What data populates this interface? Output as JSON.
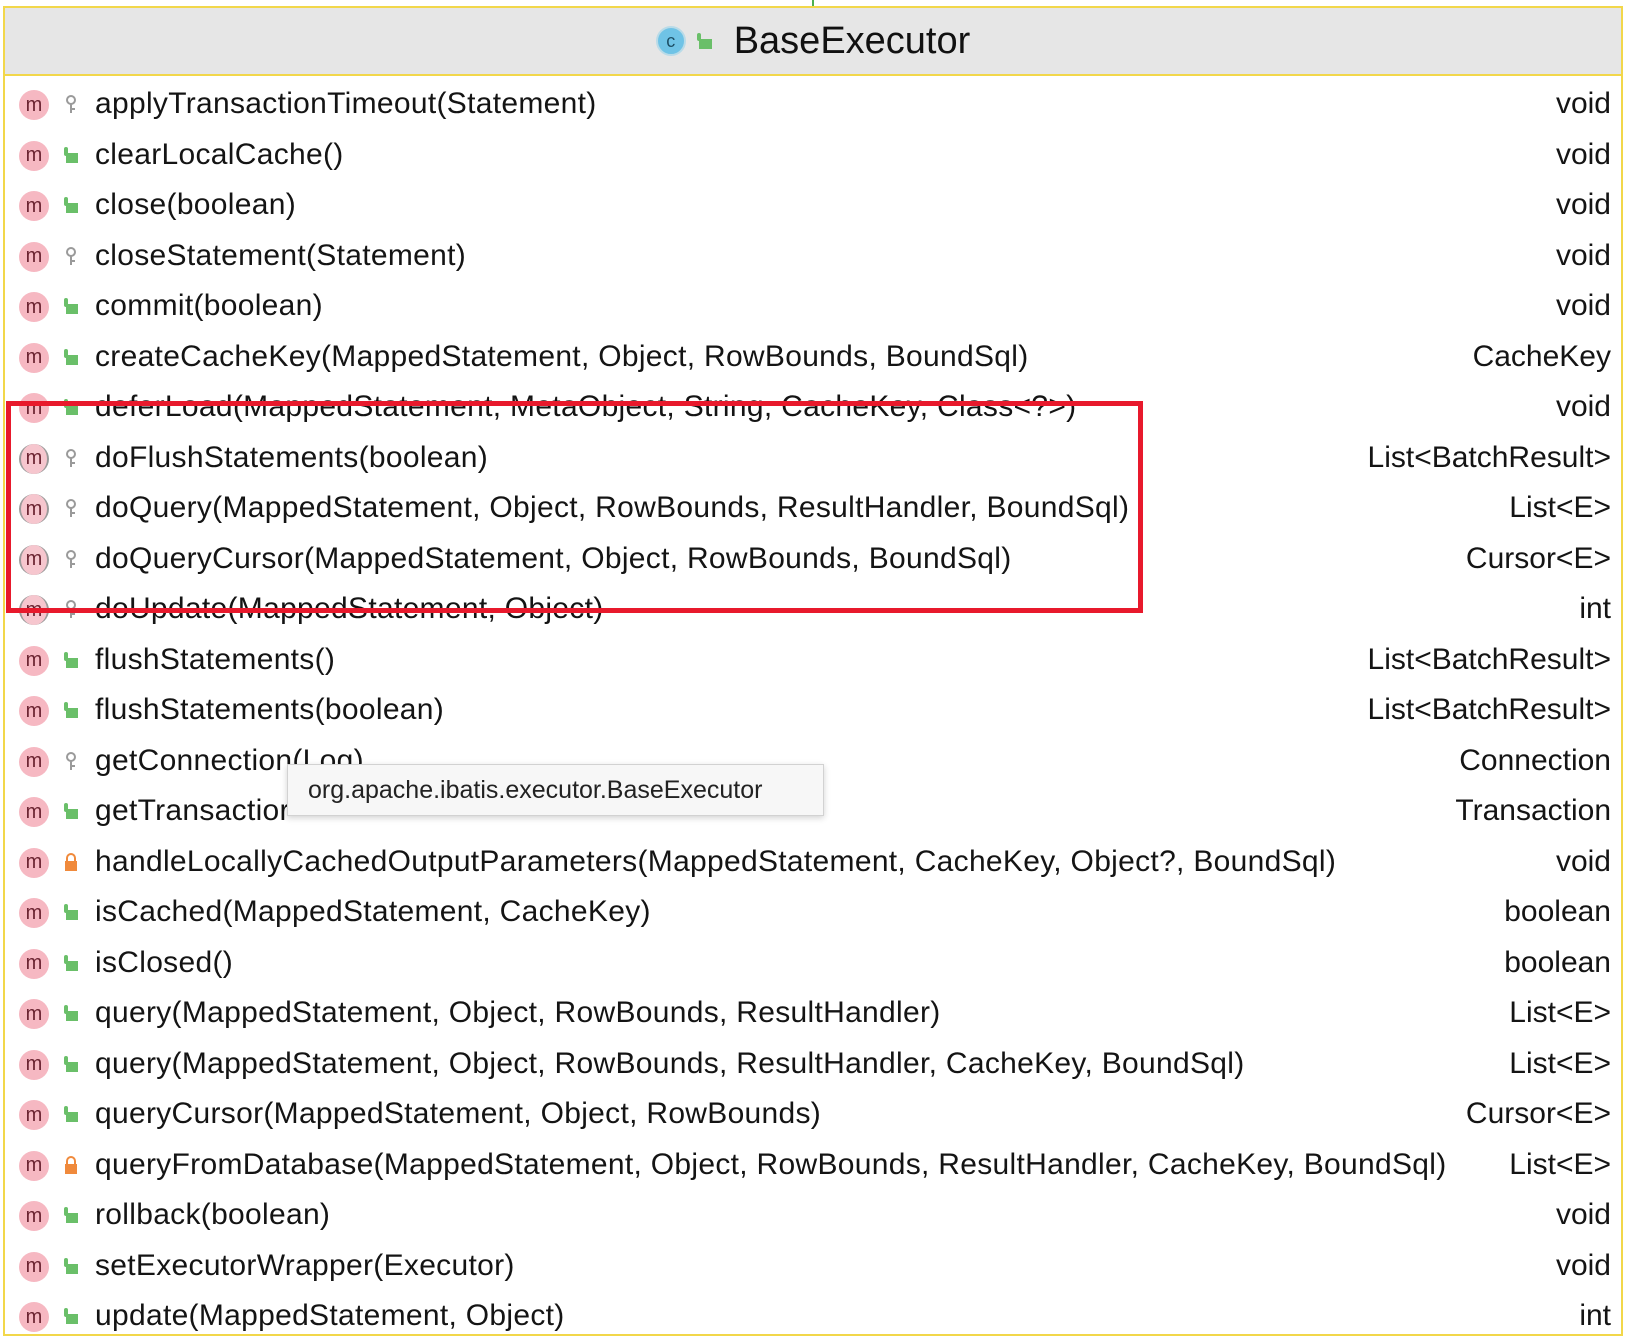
{
  "class": {
    "icon_letter": "c",
    "title": "BaseExecutor"
  },
  "colors": {
    "border": "#f2d74a",
    "header_bg": "#e6e6e6",
    "method_icon": "#f6b8c2",
    "public_icon": "#6abf69",
    "protected_icon": "#9a9a9a",
    "private_icon": "#f08a3c",
    "highlight": "#e8192c"
  },
  "methods": [
    {
      "icon": "m",
      "visibility": "protected",
      "name": "applyTransactionTimeout(Statement)",
      "return": "void"
    },
    {
      "icon": "m",
      "visibility": "public",
      "name": "clearLocalCache()",
      "return": "void"
    },
    {
      "icon": "m",
      "visibility": "public",
      "name": "close(boolean)",
      "return": "void"
    },
    {
      "icon": "m",
      "visibility": "protected",
      "name": "closeStatement(Statement)",
      "return": "void"
    },
    {
      "icon": "m",
      "visibility": "public",
      "name": "commit(boolean)",
      "return": "void"
    },
    {
      "icon": "m",
      "visibility": "public",
      "name": "createCacheKey(MappedStatement, Object, RowBounds, BoundSql)",
      "return": "CacheKey"
    },
    {
      "icon": "m",
      "visibility": "public",
      "name": "deferLoad(MappedStatement, MetaObject, String, CacheKey, Class<?>)",
      "return": "void"
    },
    {
      "icon": "m",
      "visibility": "protected",
      "abstract": true,
      "name": "doFlushStatements(boolean)",
      "return": "List<BatchResult>"
    },
    {
      "icon": "m",
      "visibility": "protected",
      "abstract": true,
      "name": "doQuery(MappedStatement, Object, RowBounds, ResultHandler, BoundSql)",
      "return": "List<E>"
    },
    {
      "icon": "m",
      "visibility": "protected",
      "abstract": true,
      "name": "doQueryCursor(MappedStatement, Object, RowBounds, BoundSql)",
      "return": "Cursor<E>"
    },
    {
      "icon": "m",
      "visibility": "protected",
      "abstract": true,
      "name": "doUpdate(MappedStatement, Object)",
      "return": "int"
    },
    {
      "icon": "m",
      "visibility": "public",
      "name": "flushStatements()",
      "return": "List<BatchResult>"
    },
    {
      "icon": "m",
      "visibility": "public",
      "name": "flushStatements(boolean)",
      "return": "List<BatchResult>"
    },
    {
      "icon": "m",
      "visibility": "protected",
      "name": "getConnection(Log)",
      "return": "Connection"
    },
    {
      "icon": "m",
      "visibility": "public",
      "name": "getTransactior",
      "return": "Transaction"
    },
    {
      "icon": "m",
      "visibility": "private",
      "name": "handleLocallyCachedOutputParameters(MappedStatement, CacheKey, Object?, BoundSql)",
      "return": "void"
    },
    {
      "icon": "m",
      "visibility": "public",
      "name": "isCached(MappedStatement, CacheKey)",
      "return": "boolean"
    },
    {
      "icon": "m",
      "visibility": "public",
      "name": "isClosed()",
      "return": "boolean"
    },
    {
      "icon": "m",
      "visibility": "public",
      "name": "query(MappedStatement, Object, RowBounds, ResultHandler)",
      "return": "List<E>"
    },
    {
      "icon": "m",
      "visibility": "public",
      "name": "query(MappedStatement, Object, RowBounds, ResultHandler, CacheKey, BoundSql)",
      "return": "List<E>"
    },
    {
      "icon": "m",
      "visibility": "public",
      "name": "queryCursor(MappedStatement, Object, RowBounds)",
      "return": "Cursor<E>"
    },
    {
      "icon": "m",
      "visibility": "private",
      "name": "queryFromDatabase(MappedStatement, Object, RowBounds, ResultHandler, CacheKey, BoundSql)",
      "return": "List<E>"
    },
    {
      "icon": "m",
      "visibility": "public",
      "name": "rollback(boolean)",
      "return": "void"
    },
    {
      "icon": "m",
      "visibility": "public",
      "name": "setExecutorWrapper(Executor)",
      "return": "void"
    },
    {
      "icon": "m",
      "visibility": "public",
      "name": "update(MappedStatement, Object)",
      "return": "int"
    }
  ],
  "tooltip": {
    "text": "org.apache.ibatis.executor.BaseExecutor"
  }
}
